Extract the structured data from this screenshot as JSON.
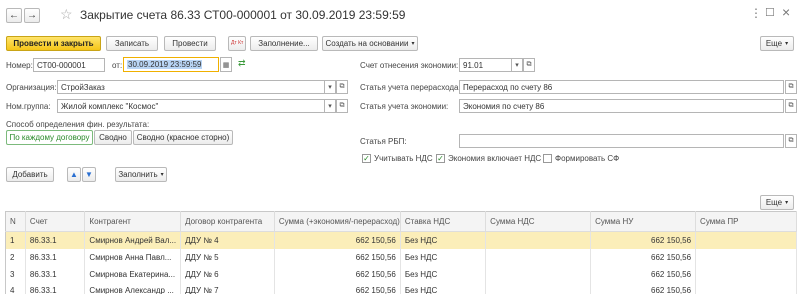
{
  "window": {
    "title": "Закрытие счета 86.33 СТ00-000001 от 30.09.2019 23:59:59"
  },
  "toolbar": {
    "post_close": "Провести и закрыть",
    "save": "Записать",
    "post": "Провести",
    "fill": "Заполнение...",
    "create_based": "Создать на основании",
    "more": "Еще",
    "dtkt_icon": "Дт Кт"
  },
  "form": {
    "number_label": "Номер:",
    "number_value": "СТ00-000001",
    "date_label": "от:",
    "date_value": "30.09.2019 23:59:59",
    "org_label": "Организация:",
    "org_value": "СтройЗаказ",
    "nomgroup_label": "Ном.группа:",
    "nomgroup_value": "Жилой комплекс \"Космос\"",
    "method_label": "Способ определения фин. результата:",
    "method_options": [
      "По каждому договору",
      "Сводно",
      "Сводно (красное сторно)"
    ],
    "economy_acc_label": "Счет отнесения экономии:",
    "economy_acc_value": "91.01",
    "overspend_item_label": "Статья учета перерасхода:",
    "overspend_item_value": "Перерасход по счету 86",
    "economy_item_label": "Статья учета экономии:",
    "economy_item_value": "Экономия по счету 86",
    "rbp_label": "Статья РБП:",
    "rbp_value": "",
    "vat_check": "Учитывать НДС",
    "economy_vat_check": "Экономия включает НДС",
    "invoice_check": "Формировать СФ"
  },
  "table_toolbar": {
    "add": "Добавить",
    "fill": "Заполнить",
    "more": "Еще"
  },
  "table": {
    "columns": [
      "N",
      "Счет",
      "Контрагент",
      "Договор контрагента",
      "Сумма (+экономия/-перерасход)",
      "Ставка НДС",
      "Сумма НДС",
      "Сумма НУ",
      "Сумма ПР"
    ],
    "rows": [
      [
        "1",
        "86.33.1",
        "Смирнов Андрей Вал...",
        "ДДУ № 4",
        "662 150,56",
        "Без НДС",
        "",
        "662 150,56",
        ""
      ],
      [
        "2",
        "86.33.1",
        "Смирнов Анна Павл...",
        "ДДУ № 5",
        "662 150,56",
        "Без НДС",
        "",
        "662 150,56",
        ""
      ],
      [
        "3",
        "86.33.1",
        "Смирнова Екатерина...",
        "ДДУ № 6",
        "662 150,56",
        "Без НДС",
        "",
        "662 150,56",
        ""
      ],
      [
        "4",
        "86.33.1",
        "Смирнов Александр ...",
        "ДДУ № 7",
        "662 150,56",
        "Без НДС",
        "",
        "662 150,56",
        ""
      ]
    ]
  },
  "colors": {
    "primary_button": "#f5c518",
    "selected_row": "#fbeeb9",
    "active_field_border": "#f0b000",
    "radio_active": "#2a8a2a"
  }
}
